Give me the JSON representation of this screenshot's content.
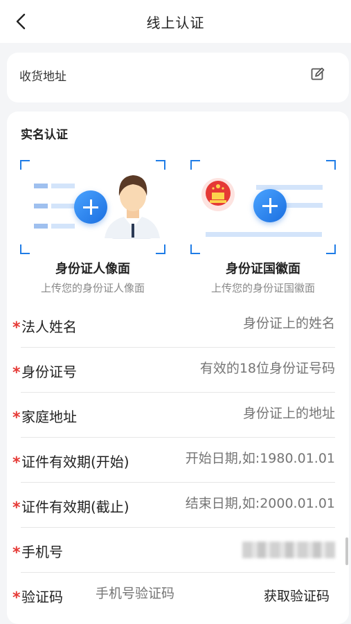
{
  "nav": {
    "title": "线上认证"
  },
  "address": {
    "label": "收货地址"
  },
  "realname": {
    "section_title": "实名认证",
    "portrait": {
      "title": "身份证人像面",
      "subtitle": "上传您的身份证人像面"
    },
    "emblem": {
      "title": "身份证国徽面",
      "subtitle": "上传您的身份证国徽面"
    }
  },
  "form": {
    "required_mark": "*",
    "fields": [
      {
        "label": "法人姓名",
        "placeholder": "身份证上的姓名"
      },
      {
        "label": "身份证号",
        "placeholder": "有效的18位身份证号码"
      },
      {
        "label": "家庭地址",
        "placeholder": "身份证上的地址"
      },
      {
        "label": "证件有效期(开始)",
        "placeholder": "开始日期,如:1980.01.01"
      },
      {
        "label": "证件有效期(截止)",
        "placeholder": "结束日期,如:2000.01.01"
      },
      {
        "label": "手机号"
      },
      {
        "label": "验证码",
        "placeholder": "手机号验证码",
        "action": "获取验证码"
      }
    ]
  },
  "colors": {
    "accent": "#1f7ce6",
    "required": "#e53935",
    "placeholder": "#b4b4b4",
    "background": "#f4f5f7"
  },
  "icons": {
    "back": "chevron-left-icon",
    "edit": "edit-icon",
    "upload": "plus-icon"
  }
}
